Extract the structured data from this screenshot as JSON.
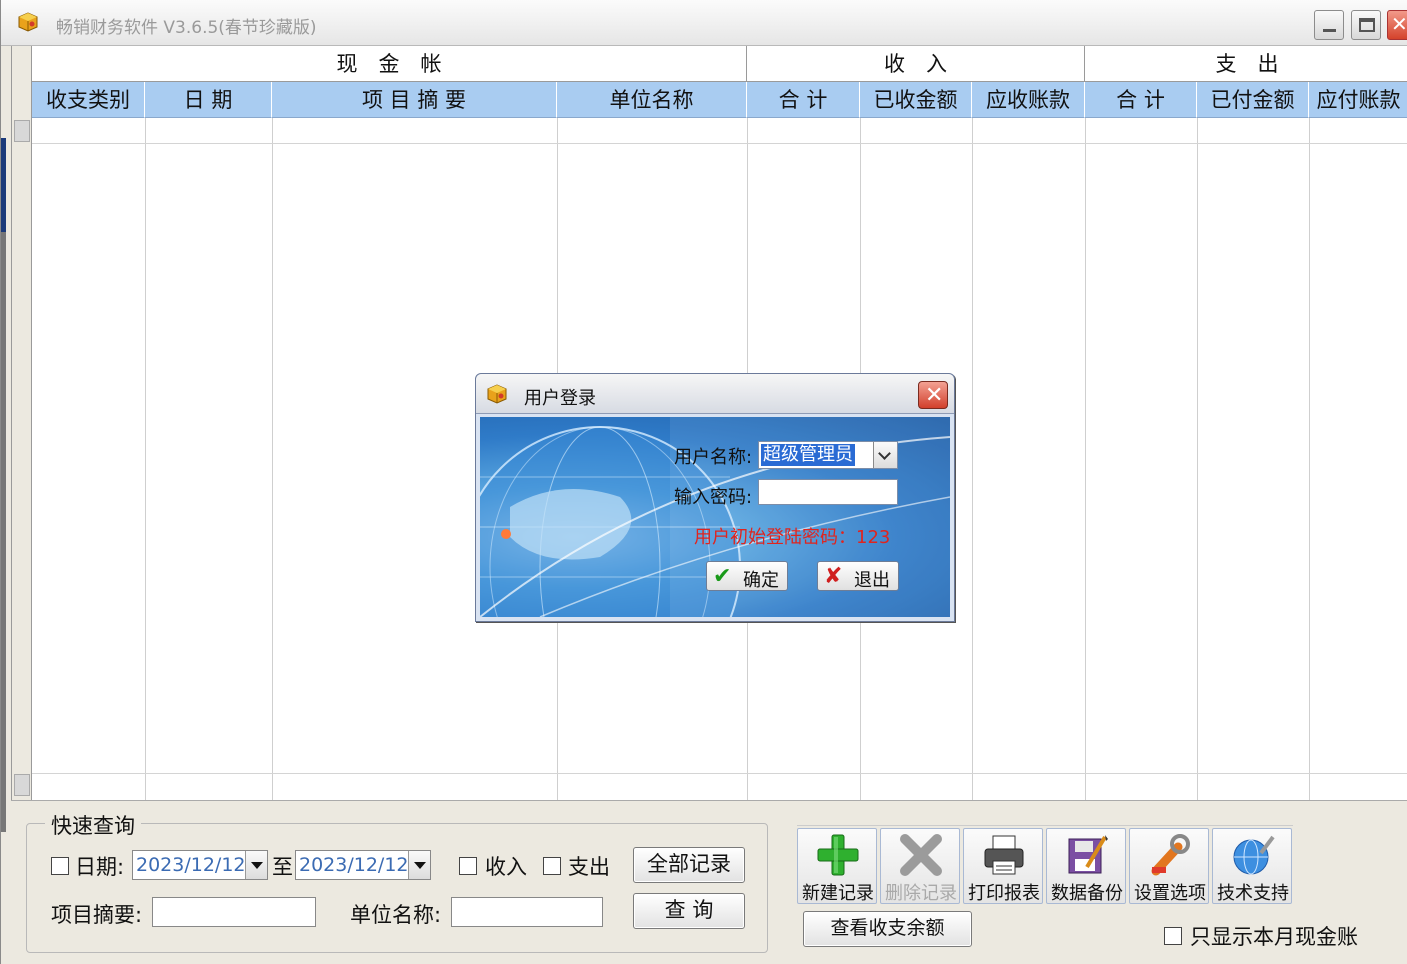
{
  "window": {
    "title": "畅销财务软件 V3.6.5(春节珍藏版)",
    "accent": "#a9ccf1"
  },
  "grid": {
    "groups": [
      "现　金　帐",
      "收　入",
      "支　出"
    ],
    "columns": [
      "收支类别",
      "日 期",
      "项 目 摘 要",
      "单位名称",
      "合 计",
      "已收金额",
      "应收账款",
      "合 计",
      "已付金额",
      "应付账款"
    ]
  },
  "query": {
    "title": "快速查询",
    "date_label": "日期:",
    "date_from": "2023/12/12",
    "to_label": "至",
    "date_to": "2023/12/12",
    "income_label": "收入",
    "expense_label": "支出",
    "all_records_button": "全部记录",
    "summary_label": "项目摘要:",
    "unit_label": "单位名称:",
    "search_button": "查 询"
  },
  "toolbar": {
    "items": [
      {
        "label": "新建记录",
        "icon": "plus-icon"
      },
      {
        "label": "删除记录",
        "icon": "delete-x-icon"
      },
      {
        "label": "打印报表",
        "icon": "printer-icon"
      },
      {
        "label": "数据备份",
        "icon": "floppy-icon"
      },
      {
        "label": "设置选项",
        "icon": "wrench-icon"
      },
      {
        "label": "技术支持",
        "icon": "globe-icon"
      }
    ],
    "balance_button": "查看收支余额",
    "month_only_label": "只显示本月现金账"
  },
  "login": {
    "title": "用户登录",
    "username_label": "用户名称:",
    "username_value": "超级管理员",
    "password_label": "输入密码:",
    "hint": "用户初始登陆密码：123",
    "ok_button": "确定",
    "exit_button": "退出"
  }
}
